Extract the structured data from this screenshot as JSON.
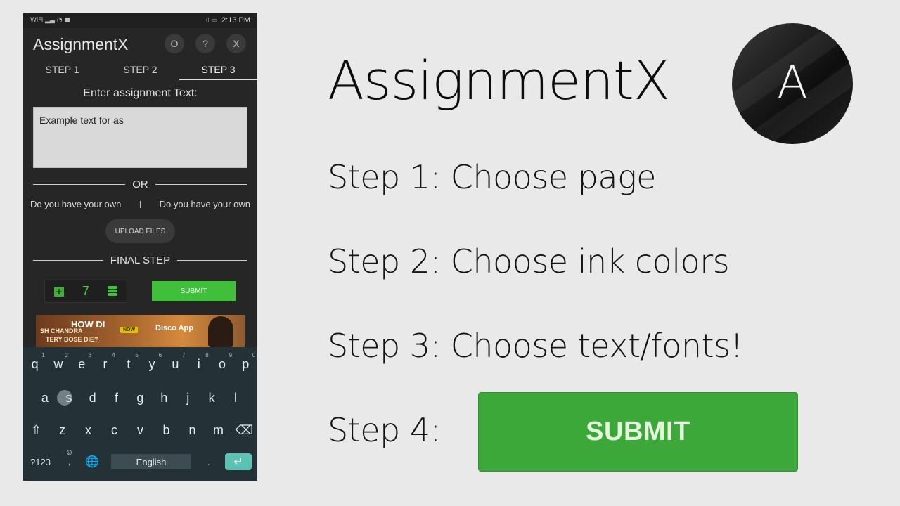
{
  "status_bar": {
    "left_glyphs": "WiFi ▂▃ ◔ ■",
    "right_glyphs": "▯ ▭",
    "time": "2:13 PM"
  },
  "app": {
    "title": "AssignmentX",
    "icons": [
      {
        "name": "O",
        "label": "O"
      },
      {
        "name": "help",
        "label": "?"
      },
      {
        "name": "close",
        "label": "X"
      }
    ]
  },
  "tabs": [
    {
      "label": "STEP 1",
      "active": false
    },
    {
      "label": "STEP 2",
      "active": false
    },
    {
      "label": "STEP 3",
      "active": true
    }
  ],
  "form": {
    "enter_label": "Enter assignment Text:",
    "text_value": "Example text for as",
    "or_label": "OR",
    "own_left": "Do you have your own",
    "own_right": "Do you have your own",
    "upload_label": "UPLOAD FILES",
    "final_step_label": "FINAL STEP",
    "counter_value": "7",
    "submit_label": "SUBMIT"
  },
  "ad": {
    "headline": "HOW DI",
    "line2": "SH CHANDRA",
    "line3": "TERY   BOSE DIE?",
    "badge": "NOW",
    "brand": "Disco App"
  },
  "keyboard": {
    "row1": [
      {
        "k": "q",
        "n": "1"
      },
      {
        "k": "w",
        "n": "2"
      },
      {
        "k": "e",
        "n": "3"
      },
      {
        "k": "r",
        "n": "4"
      },
      {
        "k": "t",
        "n": "5"
      },
      {
        "k": "y",
        "n": "6"
      },
      {
        "k": "u",
        "n": "7"
      },
      {
        "k": "i",
        "n": "8"
      },
      {
        "k": "o",
        "n": "9"
      },
      {
        "k": "p",
        "n": "0"
      }
    ],
    "row2": [
      "a",
      "s",
      "d",
      "f",
      "g",
      "h",
      "j",
      "k",
      "l"
    ],
    "row3": [
      "z",
      "x",
      "c",
      "v",
      "b",
      "n",
      "m"
    ],
    "symbols_label": "?123",
    "emoji_glyph": "☺",
    "comma_glyph": ",",
    "globe_glyph": "🌐",
    "space_label": "English",
    "period_glyph": ".",
    "shift_glyph": "⇧",
    "backspace_glyph": "⌫",
    "enter_glyph": "↵",
    "pressed_key": "s"
  },
  "slide": {
    "title": "AssignmentX",
    "logo_letter": "A",
    "steps": [
      "Step 1: Choose page",
      "Step 2: Choose ink colors",
      "Step 3: Choose text/fonts!",
      "Step 4:"
    ],
    "submit_label": "SUBMIT"
  },
  "colors": {
    "accent_green": "#3da83a",
    "phone_bg": "#262626",
    "keyboard_bg": "#243238",
    "enter_key": "#5cc2b4"
  }
}
